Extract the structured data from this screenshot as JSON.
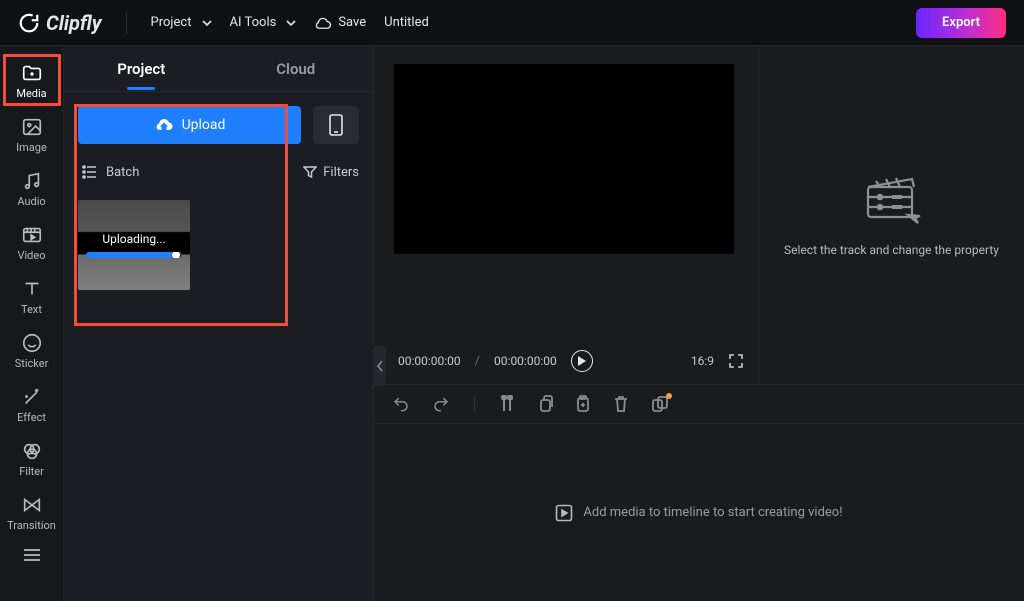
{
  "app": {
    "name": "Clipfly"
  },
  "topbar": {
    "project_label": "Project",
    "aitools_label": "AI Tools",
    "save_label": "Save",
    "title": "Untitled",
    "export_label": "Export"
  },
  "rail": {
    "items": [
      {
        "id": "media",
        "label": "Media",
        "active": true
      },
      {
        "id": "image",
        "label": "Image"
      },
      {
        "id": "audio",
        "label": "Audio"
      },
      {
        "id": "video",
        "label": "Video"
      },
      {
        "id": "text",
        "label": "Text"
      },
      {
        "id": "sticker",
        "label": "Sticker"
      },
      {
        "id": "effect",
        "label": "Effect"
      },
      {
        "id": "filter",
        "label": "Filter"
      },
      {
        "id": "transition",
        "label": "Transition"
      }
    ]
  },
  "panel": {
    "tabs": {
      "project": "Project",
      "cloud": "Cloud"
    },
    "upload_label": "Upload",
    "batch_label": "Batch",
    "filters_label": "Filters",
    "uploading_label": "Uploading...",
    "upload_progress_pct": 90
  },
  "preview": {
    "current_time": "00:00:00:00",
    "total_time": "00:00:00:00",
    "aspect_ratio": "16:9"
  },
  "properties": {
    "placeholder": "Select the track and change the property"
  },
  "timeline": {
    "placeholder": "Add media to timeline to start creating video!"
  }
}
